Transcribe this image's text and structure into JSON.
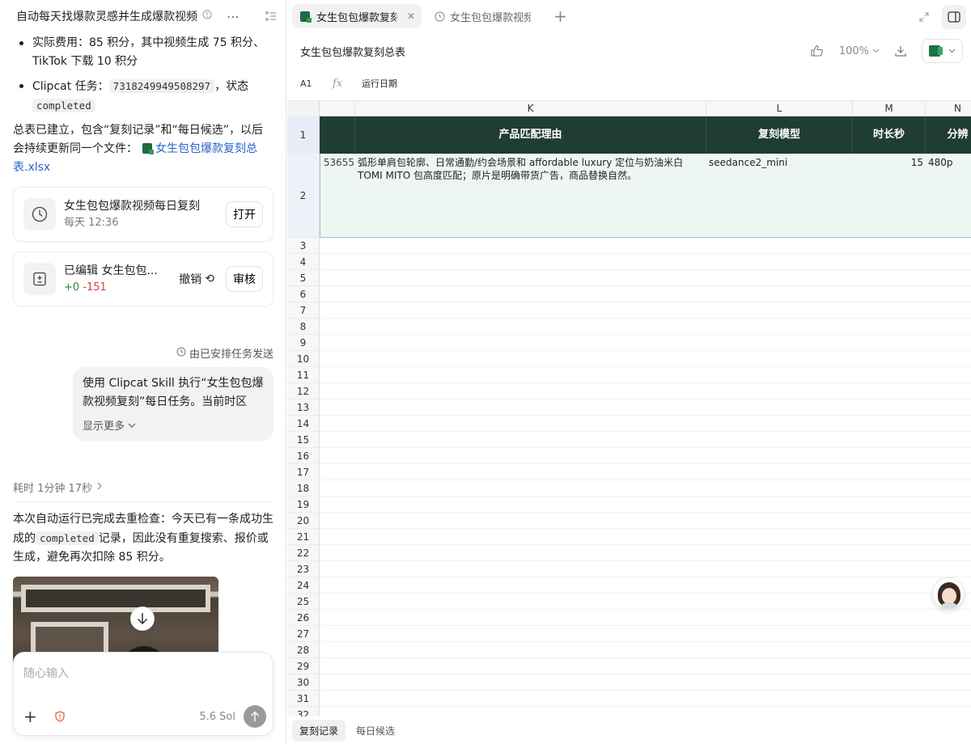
{
  "chat": {
    "title": "自动每天找爆款灵感并生成爆款视频",
    "bullets": [
      {
        "text": "实际费用：85 积分，其中视频生成 75 积分、TikTok 下载 10 积分"
      },
      {
        "prefix": "Clipcat 任务：",
        "code": "7318249949508297",
        "mid": "，状态",
        "code2": "completed"
      }
    ],
    "summary_prefix": "总表已建立，包含“复刻记录”和“每日候选”，以后会持续更新同一个文件：",
    "summary_link": "女生包包爆款复刻总表.xlsx",
    "schedule_card": {
      "title": "女生包包爆款视频每日复刻",
      "subtitle": "每天 12:36",
      "button": "打开"
    },
    "edit_card": {
      "title": "已编辑 女生包包...",
      "plus": "+0",
      "minus": "-151",
      "undo": "撤销",
      "review": "审核"
    },
    "scheduled_note": "由已安排任务发送",
    "user_message": "使用 Clipcat Skill 执行“女生包包爆款视频复刻”每日任务。当前时区",
    "show_more": "显示更多",
    "elapsed": "耗时 1分钟 17秒",
    "result_a": "本次自动运行已完成去重检查：今天已有一条成功生成的",
    "result_code": "completed",
    "result_b": "记录，因此没有重复搜索、报价或生成，避免再次扣除 85 积分。",
    "input_placeholder": "随心输入",
    "sol": "5.6 Sol"
  },
  "tabs": [
    {
      "label": "女生包包爆款复刻总表",
      "active": true
    },
    {
      "label": "女生包包爆款视频每日复刻",
      "active": false
    }
  ],
  "sheet": {
    "title": "女生包包爆款复刻总表",
    "zoom": "100%",
    "cell_ref": "A1",
    "fx": "fx",
    "formula_value": "运行日期",
    "columns": [
      {
        "label": "",
        "w": 44
      },
      {
        "label": "K",
        "w": 434
      },
      {
        "label": "L",
        "w": 181
      },
      {
        "label": "M",
        "w": 90
      },
      {
        "label": "N",
        "w": 80
      }
    ],
    "header_row": [
      "",
      "产品匹配理由",
      "复刻模型",
      "时长秒",
      "分辨"
    ],
    "data_row": [
      "53655",
      "弧形单肩包轮廓、日常通勤/约会场景和 affordable luxury 定位与奶油米白 TOMI MITO 包高度匹配；原片是明确带货广告，商品替换自然。",
      "seedance2_mini",
      "15",
      "480p"
    ],
    "row_numbers": [
      "1",
      "2",
      "3",
      "4",
      "5",
      "6",
      "7",
      "8",
      "9",
      "10",
      "11",
      "12",
      "13",
      "14",
      "15",
      "16",
      "17",
      "18",
      "19",
      "20",
      "21",
      "22",
      "23",
      "24",
      "25",
      "26",
      "27",
      "28",
      "29",
      "30",
      "31",
      "32"
    ],
    "sheet_tabs": [
      {
        "label": "复刻记录",
        "active": true
      },
      {
        "label": "每日候选",
        "active": false
      }
    ]
  },
  "colors": {
    "header_bg": "#1f3d33",
    "header_text": "#ffffff",
    "row2_bg": "#eef6f2",
    "link": "#2a63c9"
  }
}
